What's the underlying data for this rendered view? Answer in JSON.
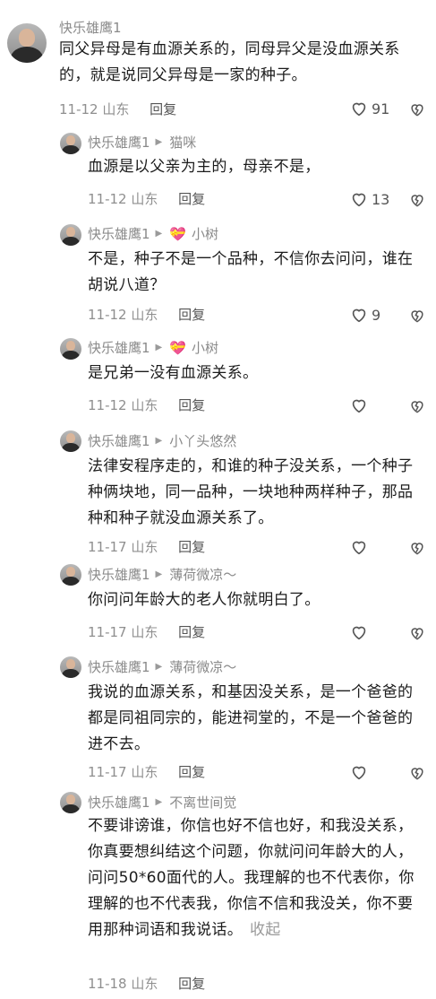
{
  "colors": {
    "text": "#1c1c1c",
    "meta": "#8f8f8f",
    "username": "#8a8a8a",
    "background": "#ffffff"
  },
  "comments": [
    {
      "username": "快乐雄鹰1",
      "to": "",
      "text": "同父异母是有血源关系的，同母异父是没血源关系的，就是说同父异母是一家的种子。",
      "date": "11-12",
      "location": "山东",
      "reply": "回复",
      "likes": "91"
    },
    {
      "username": "快乐雄鹰1",
      "to": "猫咪",
      "text": "血源是以父亲为主的，母亲不是，",
      "date": "11-12",
      "location": "山东",
      "reply": "回复",
      "likes": "13"
    },
    {
      "username": "快乐雄鹰1",
      "to": "小树",
      "text": "不是，种子不是一个品种，不信你去问问，谁在胡说八道？",
      "date": "11-12",
      "location": "山东",
      "reply": "回复",
      "likes": "9"
    },
    {
      "username": "快乐雄鹰1",
      "to": "小树",
      "text": "是兄弟一没有血源关系。",
      "date": "11-12",
      "location": "山东",
      "reply": "回复",
      "likes": ""
    },
    {
      "username": "快乐雄鹰1",
      "to": "小丫头悠然",
      "text": "法律安程序走的，和谁的种子没关系，一个种子种俩块地，同一品种，一块地种两样种子，那品种和种子就没血源关系了。",
      "date": "11-17",
      "location": "山东",
      "reply": "回复",
      "likes": ""
    },
    {
      "username": "快乐雄鹰1",
      "to": "薄荷微凉～",
      "text": "你问问年龄大的老人你就明白了。",
      "date": "11-17",
      "location": "山东",
      "reply": "回复",
      "likes": ""
    },
    {
      "username": "快乐雄鹰1",
      "to": "薄荷微凉～",
      "text": "我说的血源关系，和基因没关系，是一个爸爸的都是同祖同宗的，能进祠堂的，不是一个爸爸的进不去。",
      "date": "11-17",
      "location": "山东",
      "reply": "回复",
      "likes": ""
    },
    {
      "username": "快乐雄鹰1",
      "to": "不离世间觉",
      "text": "不要诽谤谁，你信也好不信也好，和我没关系，你真要想纠结这个问题，你就问问年龄大的人，问问50*60面代的人。我理解的也不代表你，你理解的也不代表我，你信不信和我没关，你不要用那种词语和我说话。",
      "collapse": "收起",
      "date": "11-18",
      "location": "山东",
      "reply": "回复",
      "likes": ""
    }
  ]
}
